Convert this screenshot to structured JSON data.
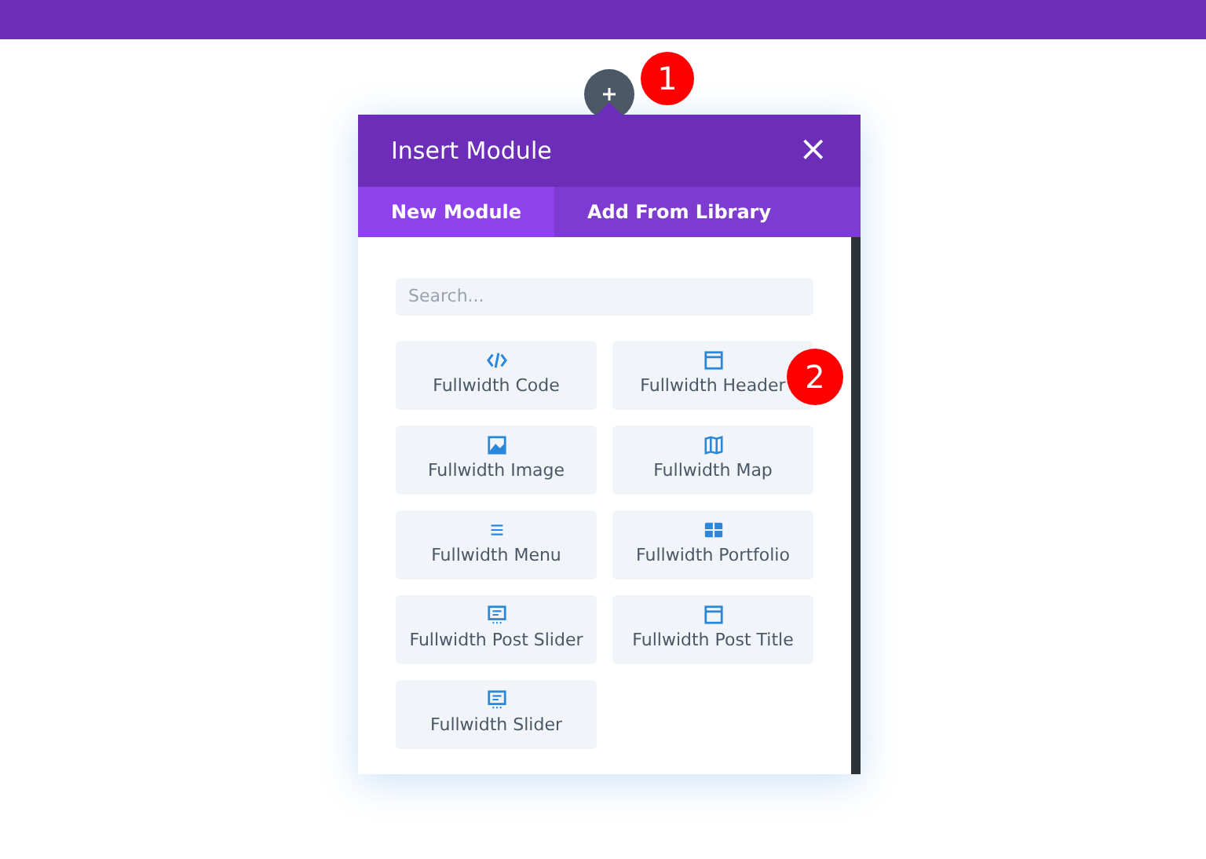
{
  "badges": [
    "1",
    "2"
  ],
  "dialog": {
    "title": "Insert Module",
    "close": "×",
    "tabs": [
      {
        "label": "New Module",
        "selected": true
      },
      {
        "label": "Add From Library",
        "selected": false
      }
    ],
    "search": {
      "placeholder": "Search..."
    },
    "modules": [
      {
        "label": "Fullwidth Code",
        "kind": "code"
      },
      {
        "label": "Fullwidth Header",
        "kind": "header"
      },
      {
        "label": "Fullwidth Image",
        "kind": "image"
      },
      {
        "label": "Fullwidth Map",
        "kind": "map"
      },
      {
        "label": "Fullwidth Menu",
        "kind": "menu"
      },
      {
        "label": "Fullwidth Portfolio",
        "kind": "portfolio"
      },
      {
        "label": "Fullwidth Post Slider",
        "kind": "slider"
      },
      {
        "label": "Fullwidth Post Title",
        "kind": "header"
      },
      {
        "label": "Fullwidth Slider",
        "kind": "slider"
      }
    ]
  }
}
